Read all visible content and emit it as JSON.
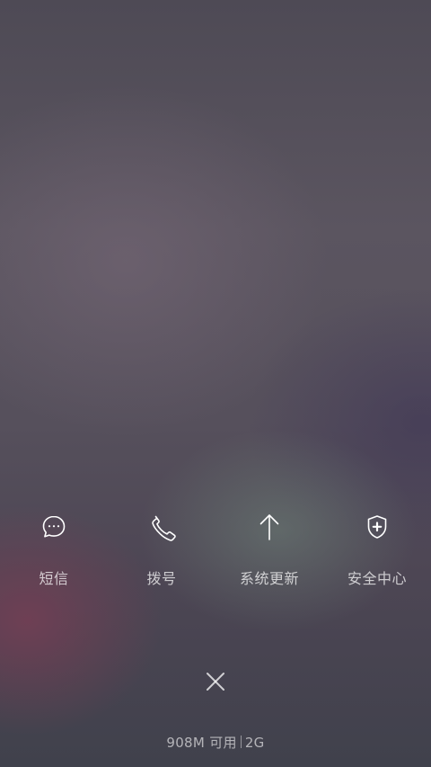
{
  "shortcuts": [
    {
      "label": "短信",
      "icon": "message-icon"
    },
    {
      "label": "拨号",
      "icon": "phone-icon"
    },
    {
      "label": "系统更新",
      "icon": "arrow-up-icon"
    },
    {
      "label": "安全中心",
      "icon": "shield-icon"
    }
  ],
  "close": {
    "icon": "close-icon"
  },
  "memory": {
    "available": "908M 可用",
    "total": "2G"
  },
  "colors": {
    "foreground": "#ffffff"
  }
}
